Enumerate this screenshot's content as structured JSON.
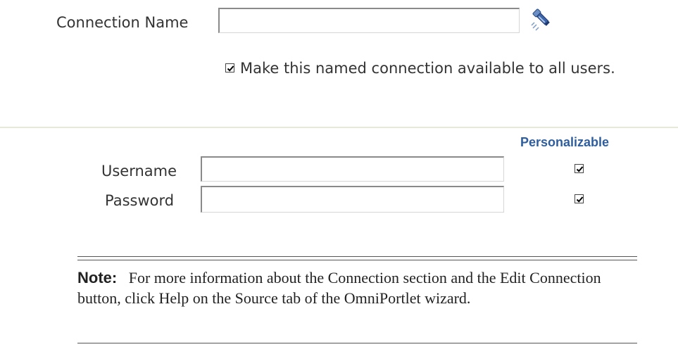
{
  "connection": {
    "label": "Connection Name",
    "value": "",
    "lookup_icon": "flashlight-icon",
    "share_checked": true,
    "share_label": "Make this named connection available to all users."
  },
  "credentials": {
    "personalizable_header": "Personalizable",
    "accent_color": "#2e5e9e",
    "username_label": "Username",
    "username_value": "",
    "username_personalizable": true,
    "password_label": "Password",
    "password_value": "",
    "password_personalizable": true
  },
  "note": {
    "label": "Note:",
    "text": "For more information about the Connection section and the Edit Connection button, click Help on the Source tab of the OmniPortlet wizard."
  }
}
